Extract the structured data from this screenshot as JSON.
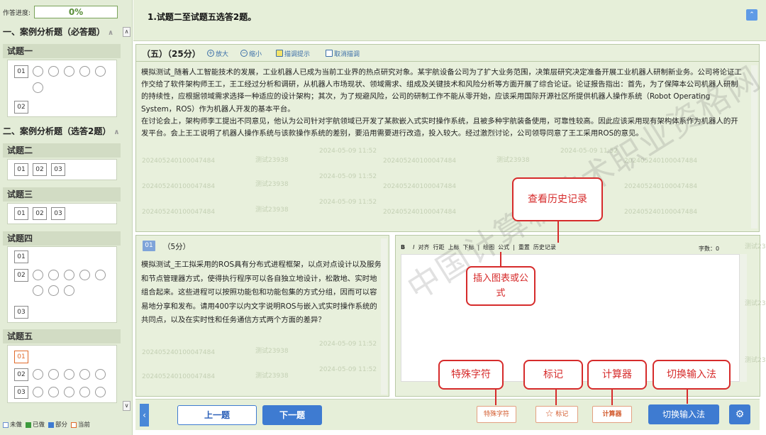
{
  "sidebar": {
    "progress_label": "作答进度:",
    "progress_value": "0%",
    "section1_title": "一、案例分析题（必答题）",
    "section2_title": "二、案例分析题（选答2题）",
    "groups": [
      {
        "title": "试题一",
        "nums": [
          "01",
          "02"
        ]
      },
      {
        "title": "试题二",
        "nums": [
          "01",
          "02",
          "03"
        ]
      },
      {
        "title": "试题三",
        "nums": [
          "01",
          "02",
          "03"
        ]
      },
      {
        "title": "试题四",
        "nums": [
          "01",
          "02",
          "03"
        ]
      },
      {
        "title": "试题五",
        "nums": [
          "01",
          "02",
          "03"
        ]
      }
    ],
    "legend": {
      "unanswered": "未做",
      "answered": "已做",
      "partial": "部分",
      "current": "当前"
    }
  },
  "header": {
    "title": "1.试题二至试题五选答2题。"
  },
  "main": {
    "section_label": "（五）（25分）",
    "tools": {
      "zoom_in": "放大",
      "zoom_out": "缩小",
      "highlight": "描调提示",
      "cancel_highlight": "取消描调"
    },
    "passage_p1": "模拟测试_随着人工智能技术的发展，工业机器人已成为当前工业界的热点研究对象。某宇航设备公司为了扩大业务范围，决策层研究决定准备开展工业机器人研制新业务。公司将论证工作交给了软件架构师王工，王工经过分析和调研，从机器人市场现状、领域需求、组成及关键技术和风险分析等方面开展了综合论证。论证报告指出：首先，为了保障本公司机器人研制的持续性，应根据领域需求选择一种适应的设计架构；其次，为了规避风险，公司的研制工作不能从零开始，应该采用国际开源社区所提供机器人操作系统（Robot Operating System，ROS）作为机器人开发的基本平台。",
    "passage_p2": "在讨论会上，架构师李工提出不同意见，他认为公司针对宇航领域已开发了某款嵌入式实时操作系统，且被多种宇航装备使用，可靠性较高。因此应该采用现有架构体系作为机器人的开发平台。会上王工说明了机器人操作系统与该款操作系统的差别，要沿用需要进行改造，投入较大。经过激烈讨论，公司领导同意了王工采用ROS的意见。",
    "watermarks": [
      "202405240100047484",
      "测试23938",
      "2024-05-09 11:52"
    ]
  },
  "question": {
    "num": "01",
    "score": "（5分）",
    "text": "模拟测试_王工拟采用的ROS具有分布式进程框架，以点对点设计以及服务和节点管理器方式，使得执行程序可以各自独立地设计，松散地、实时地组合起来。这些进程可以按照功能包和功能包集的方式分组，因而可以容易地分享和发布。请用400字以内文字说明ROS与嵌入式实时操作系统的共同点，以及在实时性和任务通信方式两个方面的差异？"
  },
  "answer": {
    "toolbar": [
      "B",
      "I",
      "对齐",
      "行距",
      "上标",
      "下标",
      "|",
      "绘图",
      "公式",
      "|",
      "重置",
      "历史记录"
    ],
    "word_count": "字数：0"
  },
  "bottom": {
    "prev": "上一题",
    "next": "下一题",
    "special_chars": "特殊字符",
    "mark": "标记",
    "calculator": "计算器",
    "switch_ime": "切换输入法"
  },
  "callouts": {
    "history": "查看历史记录",
    "insert": "插入图表或公式",
    "special": "特殊字符",
    "mark": "标记",
    "calc": "计算器",
    "ime": "切换输入法"
  },
  "watermark_big": "中国计算机技术职业资格网",
  "colors": {
    "accent_blue": "#3e7bd1",
    "sidebar_bg": "#e3ecd7",
    "panel_bg": "#e8f0dc",
    "callout_red": "#d62b2b",
    "warn_orange": "#d2592b"
  }
}
